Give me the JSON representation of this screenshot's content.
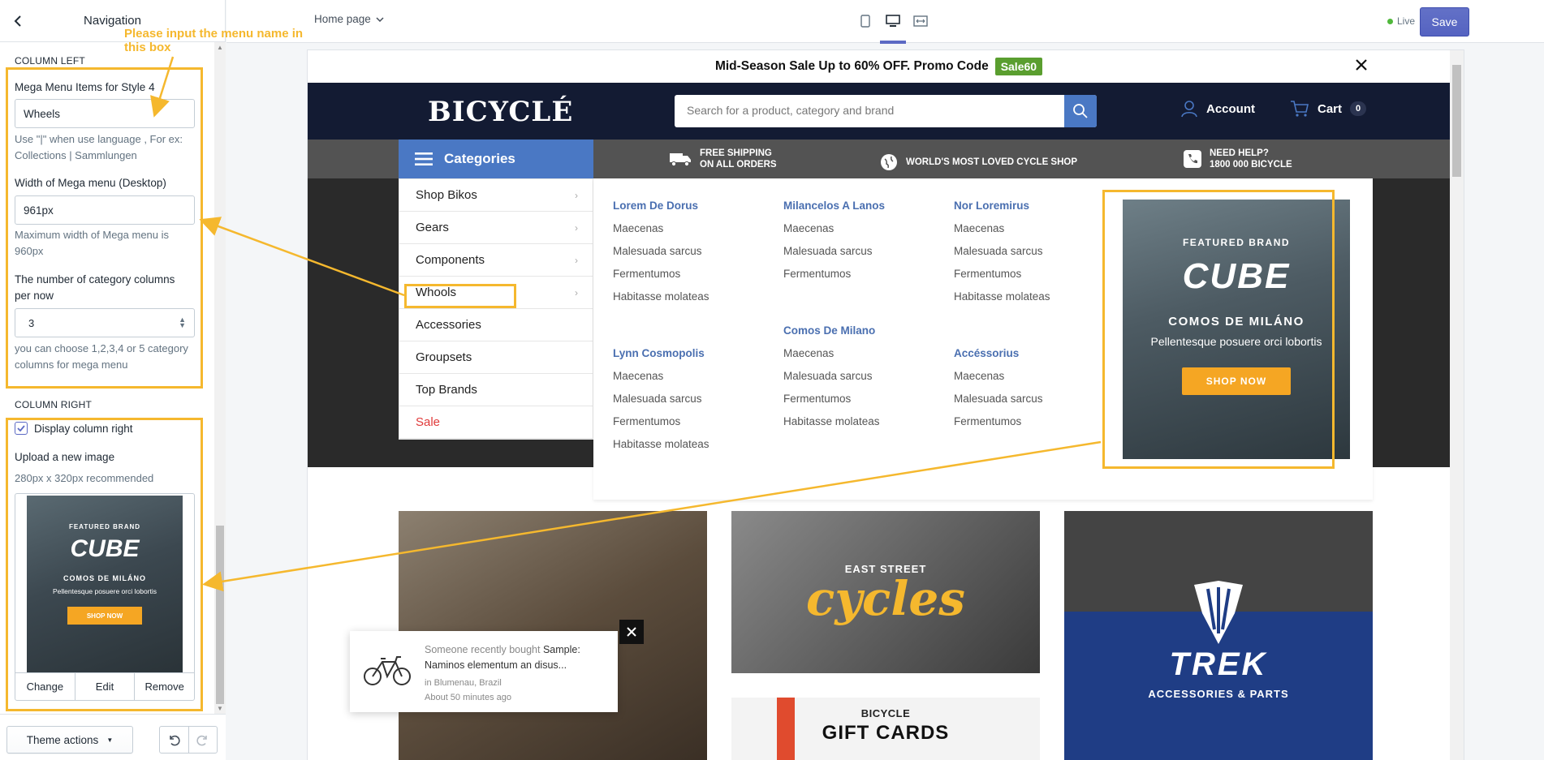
{
  "sidebar": {
    "title": "Navigation",
    "column_left_label": "COLUMN LEFT",
    "mega_items_label": "Mega Menu Items for Style 4",
    "mega_items_value": "Wheels",
    "mega_items_help": "Use \"|\" when use language , For ex: Collections | Sammlungen",
    "width_label": "Width of Mega menu (Desktop)",
    "width_value": "961px",
    "width_help": "Maximum width of Mega menu is 960px",
    "columns_label": "The number of category columns per now",
    "columns_value": "3",
    "columns_help": "you can choose 1,2,3,4 or 5 category columns for mega menu",
    "column_right_label": "COLUMN RIGHT",
    "display_right_label": "Display column right",
    "upload_label": "Upload a new image",
    "upload_help": "280px x 320px recommended",
    "img_actions": [
      "Change",
      "Edit",
      "Remove"
    ],
    "theme_actions": "Theme actions"
  },
  "annotation": {
    "note": "Please input the menu name in this box",
    "color": "#f5b82e"
  },
  "topbar": {
    "page": "Home page",
    "live": "Live",
    "save": "Save"
  },
  "store": {
    "promo_text": "Mid-Season Sale Up to 60% OFF. Promo Code",
    "promo_code": "Sale60",
    "logo": "BICYCLÉ",
    "search_placeholder": "Search for a product, category and brand",
    "account": "Account",
    "cart": "Cart",
    "cart_count": "0",
    "categories_btn": "Categories",
    "info": [
      {
        "line1": "FREE SHIPPING",
        "line2": "ON ALL ORDERS"
      },
      {
        "line1": "WORLD'S MOST LOVED CYCLE SHOP",
        "line2": ""
      },
      {
        "line1": "NEED HELP?",
        "line2": "1800 000 BICYCLE"
      }
    ],
    "categories": [
      "Shop Bikos",
      "Gears",
      "Components",
      "Whools",
      "Accessories",
      "Groupsets",
      "Top Brands",
      "Sale"
    ],
    "mega": {
      "col1": {
        "head": "Lorem De Dorus",
        "links": [
          "Maecenas",
          "Malesuada sarcus",
          "Fermentumos",
          "Habitasse molateas"
        ],
        "head2": "Lynn Cosmopolis",
        "links2": [
          "Maecenas",
          "Malesuada sarcus",
          "Fermentumos",
          "Habitasse molateas"
        ]
      },
      "col2": {
        "head": "Milancelos A Lanos",
        "links": [
          "Maecenas",
          "Malesuada sarcus",
          "Fermentumos"
        ],
        "head2": "Comos De Milano",
        "links2": [
          "Maecenas",
          "Malesuada sarcus",
          "Fermentumos",
          "Habitasse molateas"
        ]
      },
      "col3": {
        "head": "Nor Loremirus",
        "links": [
          "Maecenas",
          "Malesuada sarcus",
          "Fermentumos",
          "Habitasse molateas"
        ],
        "head2": "Accéssorius",
        "links2": [
          "Maecenas",
          "Malesuada sarcus",
          "Fermentumos"
        ]
      }
    },
    "featured": {
      "tag": "FEATURED BRAND",
      "brand": "CUBE",
      "title": "COMOS DE MILÁNO",
      "subtitle": "Pellentesque posuere orci lobortis",
      "button": "SHOP NOW"
    },
    "tiles": {
      "east_street": "EAST STREET",
      "cycles": "cycles",
      "gift_small": "BICYCLE",
      "gift_big": "GIFT CARDS",
      "trek": "TREK",
      "trek_sub": "ACCESSORIES & PARTS"
    },
    "toast": {
      "prefix": "Someone recently bought",
      "product": "Sample: Naminos elementum an disus...",
      "location": "in Blumenau, Brazil",
      "time": "About 50 minutes ago"
    }
  }
}
